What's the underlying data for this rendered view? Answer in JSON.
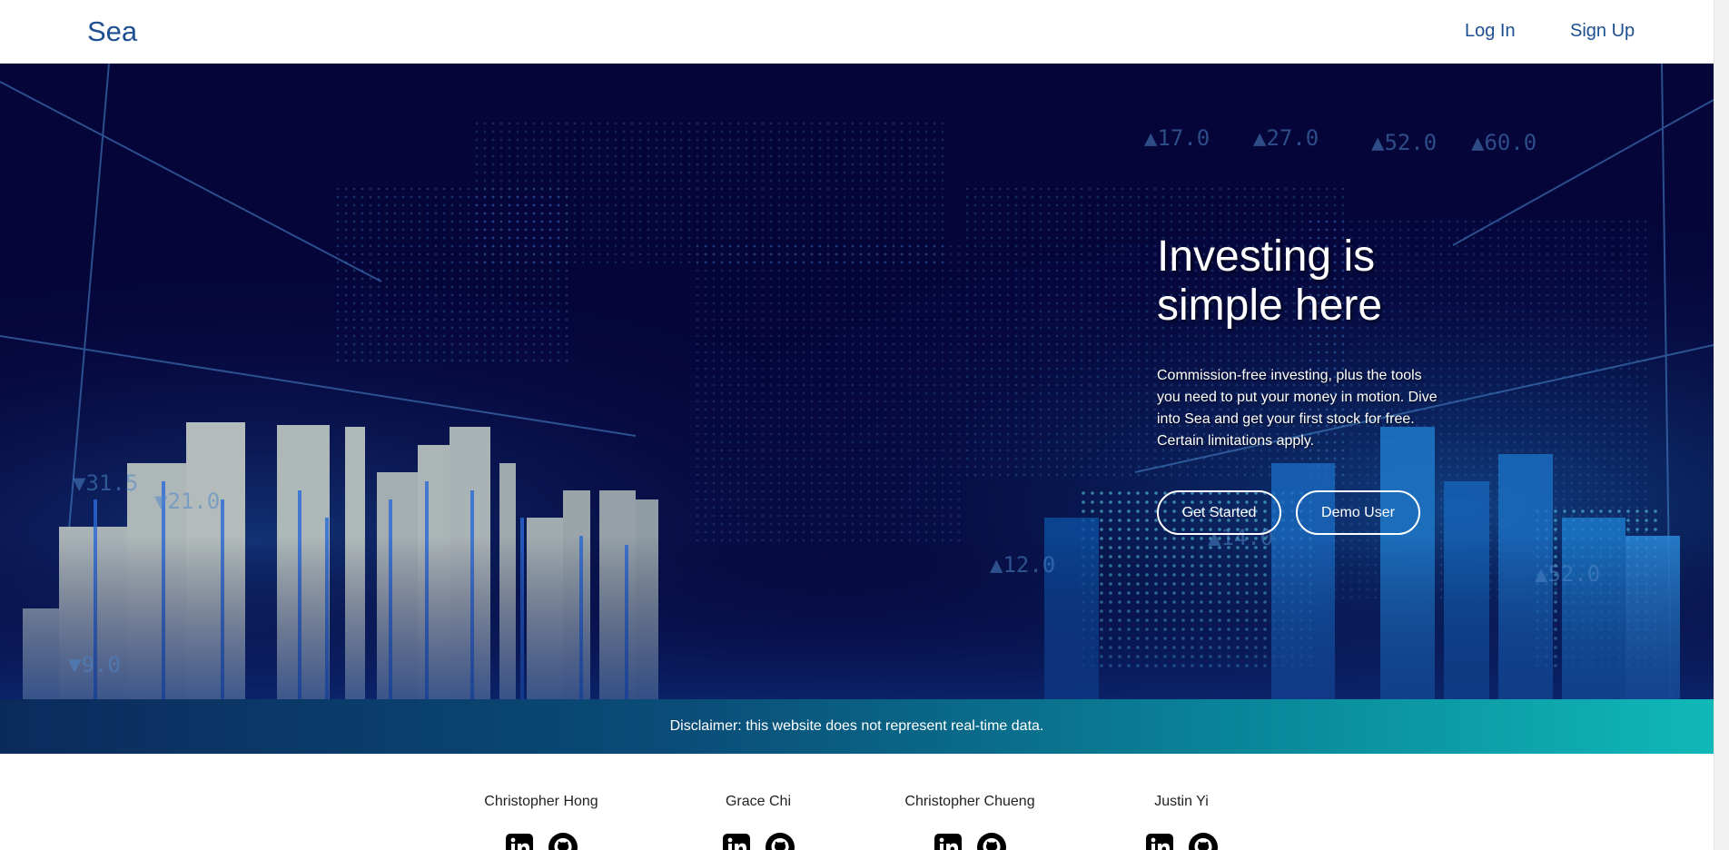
{
  "navbar": {
    "logo": "Sea",
    "login_label": "Log In",
    "signup_label": "Sign Up"
  },
  "hero": {
    "title": "Investing is simple here",
    "description": "Commission-free investing, plus the tools you need to put your money in motion. Dive into Sea and get your first stock for free. Certain limitations apply.",
    "primary_button": "Get Started",
    "secondary_button": "Demo User",
    "background_labels": [
      "▲17.0",
      "▲27.0",
      "▲52.0",
      "▲60.0",
      "▲52.0",
      "▲12.0",
      "▼21.0",
      "▼31.5",
      "▼9.0",
      "▲14.0"
    ]
  },
  "disclaimer": {
    "text": "Disclaimer: this website does not represent real-time data."
  },
  "team": {
    "members": [
      {
        "name": "Christopher Hong",
        "icons": [
          "linkedin-icon",
          "github-icon"
        ]
      },
      {
        "name": "Grace Chi",
        "icons": [
          "linkedin-icon",
          "github-icon"
        ]
      },
      {
        "name": "Christopher Chueng",
        "icons": [
          "linkedin-icon",
          "github-icon"
        ]
      },
      {
        "name": "Justin Yi",
        "icons": [
          "linkedin-icon",
          "github-icon"
        ]
      }
    ]
  },
  "colors": {
    "brand": "#1d4f91",
    "hero_bg": "#05053a",
    "disclaimer_start": "#0b2a5c",
    "disclaimer_end": "#10b8b8"
  }
}
